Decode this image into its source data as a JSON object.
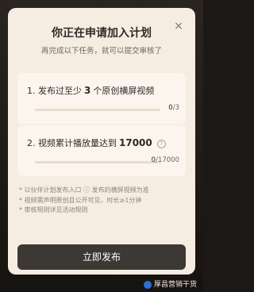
{
  "dialog": {
    "title": "你正在申请加入计划",
    "subtitle": "再完成以下任务，就可以提交审核了",
    "close_icon": "×"
  },
  "tasks": [
    {
      "prefix": "1. 发布过至少",
      "number": "3",
      "suffix": "个原创横屏视频",
      "progress_current": "0",
      "progress_total": "/3",
      "progress_fraction": 0
    },
    {
      "prefix": "2. 视频累计播放量达到",
      "number": "17000",
      "suffix": "",
      "progress_current": "0",
      "progress_total": "/17000",
      "progress_fraction": 0
    }
  ],
  "notes": [
    {
      "a": "* 以伙伴计划发布入口",
      "icon": "ⓘ",
      "b": "发布的横屏视频为准"
    },
    {
      "a": "* 视频需声明原创且公开可见，时长≥1分钟",
      "icon": "",
      "b": ""
    },
    {
      "a": "* 审核规则详见活动规则",
      "icon": "",
      "b": ""
    }
  ],
  "cta": {
    "label": "立即发布"
  },
  "watermark": {
    "text": "厚昌营销干货"
  },
  "colors": {
    "modal_bg": "#f6ede2",
    "card_bg": "#fbf5ee",
    "button_bg": "#3c3834",
    "progress_track": "#e9dccd"
  }
}
